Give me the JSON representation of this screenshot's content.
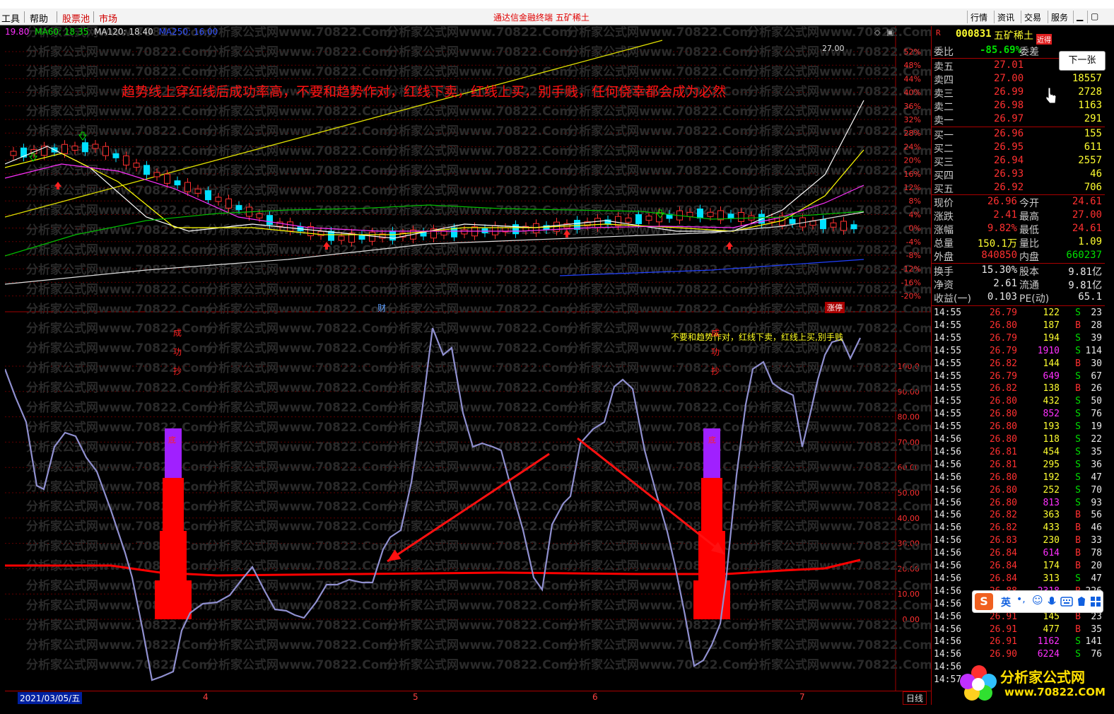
{
  "menubar": {
    "items": [
      "工具",
      "帮助",
      "股票池",
      "市场"
    ],
    "center_title": "通达信金融终端  五矿稀土",
    "right_buttons": [
      "行情",
      "资讯",
      "交易",
      "服务"
    ]
  },
  "ma_legend": {
    "ma20": "19.80",
    "ma60": "MA60: 18.35",
    "ma120": "MA120: 18.40",
    "ma250": "MA250: 16.00"
  },
  "main_chart": {
    "annotation": "趋势线上穿红线后成功率高，不要和趋势作对，红线下卖，红线上买，别手贱，任何侥幸都会成为必然",
    "high_label": "27.00",
    "pct_axis": [
      "52%",
      "48%",
      "44%",
      "40%",
      "36%",
      "32%",
      "28%",
      "24%",
      "20%",
      "16%",
      "12%",
      "8%",
      "4%",
      "0%",
      "-4%",
      "-8%",
      "-12%",
      "-16%",
      "-20%"
    ],
    "marker_cai": "财",
    "marker_zhangting": "涨停",
    "watermark": "分析家公式网www.70822.Com"
  },
  "indicator": {
    "annotation": "不要和趋势作对，红线下卖，红线上买,别手贱",
    "left_chars": [
      "成",
      "功",
      "抄"
    ],
    "right_chars": [
      "成",
      "功",
      "抄"
    ],
    "left_bottom_char": "底",
    "right_bottom_char": "底",
    "axis": [
      "100.0",
      "90.00",
      "80.00",
      "70.00",
      "60.00",
      "50.00",
      "40.00",
      "30.00",
      "20.00",
      "10.00",
      "0.00"
    ]
  },
  "date_bar": {
    "date": "2021/03/05/五",
    "months": [
      "4",
      "5",
      "6",
      "7"
    ],
    "period": "日线"
  },
  "quote": {
    "code": "000831",
    "name": "五矿稀土",
    "badge": "近得",
    "weibi_label": "委比",
    "weibi": "-85.69%",
    "weicha_label": "委差",
    "sells": [
      {
        "label": "卖五",
        "price": "27.01",
        "vol": ""
      },
      {
        "label": "卖四",
        "price": "27.00",
        "vol": "18557"
      },
      {
        "label": "卖三",
        "price": "26.99",
        "vol": "2728"
      },
      {
        "label": "卖二",
        "price": "26.98",
        "vol": "1163"
      },
      {
        "label": "卖一",
        "price": "26.97",
        "vol": "291"
      }
    ],
    "buys": [
      {
        "label": "买一",
        "price": "26.96",
        "vol": "155"
      },
      {
        "label": "买二",
        "price": "26.95",
        "vol": "611"
      },
      {
        "label": "买三",
        "price": "26.94",
        "vol": "2557"
      },
      {
        "label": "买四",
        "price": "26.93",
        "vol": "46"
      },
      {
        "label": "买五",
        "price": "26.92",
        "vol": "706"
      }
    ],
    "stats": [
      {
        "l1": "现价",
        "v1": "26.96",
        "l2": "今开",
        "v2": "24.61"
      },
      {
        "l1": "涨跌",
        "v1": "2.41",
        "l2": "最高",
        "v2": "27.00"
      },
      {
        "l1": "涨幅",
        "v1": "9.82%",
        "l2": "最低",
        "v2": "24.61"
      },
      {
        "l1": "总量",
        "v1": "150.1万",
        "l2": "量比",
        "v2": "1.09"
      },
      {
        "l1": "外盘",
        "v1": "840850",
        "l2": "内盘",
        "v2": "660237"
      }
    ],
    "stats2": [
      {
        "l1": "换手",
        "v1": "15.30%",
        "l2": "股本",
        "v2": "9.81亿"
      },
      {
        "l1": "净资",
        "v1": "2.61",
        "l2": "流通",
        "v2": "9.81亿"
      },
      {
        "l1": "收益(一)",
        "v1": "0.103",
        "l2": "PE(动)",
        "v2": "65.1"
      }
    ],
    "next_button": "下一张"
  },
  "ticks": [
    {
      "t": "14:55",
      "p": "26.79",
      "v": "122",
      "d": "S",
      "n": "23"
    },
    {
      "t": "14:55",
      "p": "26.80",
      "v": "187",
      "d": "B",
      "n": "28"
    },
    {
      "t": "14:55",
      "p": "26.79",
      "v": "194",
      "d": "S",
      "n": "39"
    },
    {
      "t": "14:55",
      "p": "26.79",
      "v": "1910",
      "d": "S",
      "n": "114"
    },
    {
      "t": "14:55",
      "p": "26.82",
      "v": "144",
      "d": "B",
      "n": "30"
    },
    {
      "t": "14:55",
      "p": "26.79",
      "v": "649",
      "d": "S",
      "n": "67"
    },
    {
      "t": "14:55",
      "p": "26.82",
      "v": "138",
      "d": "B",
      "n": "26"
    },
    {
      "t": "14:55",
      "p": "26.80",
      "v": "432",
      "d": "S",
      "n": "50"
    },
    {
      "t": "14:55",
      "p": "26.80",
      "v": "852",
      "d": "S",
      "n": "76"
    },
    {
      "t": "14:55",
      "p": "26.80",
      "v": "193",
      "d": "S",
      "n": "19"
    },
    {
      "t": "14:56",
      "p": "26.80",
      "v": "118",
      "d": "S",
      "n": "22"
    },
    {
      "t": "14:56",
      "p": "26.81",
      "v": "454",
      "d": "S",
      "n": "35"
    },
    {
      "t": "14:56",
      "p": "26.81",
      "v": "295",
      "d": "S",
      "n": "36"
    },
    {
      "t": "14:56",
      "p": "26.80",
      "v": "192",
      "d": "S",
      "n": "47"
    },
    {
      "t": "14:56",
      "p": "26.80",
      "v": "252",
      "d": "S",
      "n": "70"
    },
    {
      "t": "14:56",
      "p": "26.80",
      "v": "813",
      "d": "S",
      "n": "93"
    },
    {
      "t": "14:56",
      "p": "26.82",
      "v": "363",
      "d": "B",
      "n": "56"
    },
    {
      "t": "14:56",
      "p": "26.82",
      "v": "433",
      "d": "B",
      "n": "46"
    },
    {
      "t": "14:56",
      "p": "26.83",
      "v": "230",
      "d": "B",
      "n": "33"
    },
    {
      "t": "14:56",
      "p": "26.84",
      "v": "614",
      "d": "B",
      "n": "78"
    },
    {
      "t": "14:56",
      "p": "26.84",
      "v": "174",
      "d": "B",
      "n": "20"
    },
    {
      "t": "14:56",
      "p": "26.84",
      "v": "313",
      "d": "S",
      "n": "47"
    },
    {
      "t": "14:56",
      "p": "26.88",
      "v": "2318",
      "d": "B",
      "n": "226"
    },
    {
      "t": "14:56",
      "p": "26.88",
      "v": "",
      "d": "",
      "n": ""
    },
    {
      "t": "14:56",
      "p": "26.91",
      "v": "145",
      "d": "B",
      "n": "23"
    },
    {
      "t": "14:56",
      "p": "26.91",
      "v": "477",
      "d": "B",
      "n": "35"
    },
    {
      "t": "14:56",
      "p": "26.91",
      "v": "1162",
      "d": "S",
      "n": "141"
    },
    {
      "t": "14:56",
      "p": "26.90",
      "v": "6224",
      "d": "S",
      "n": "76"
    },
    {
      "t": "14:56",
      "p": "",
      "v": "",
      "d": "",
      "n": ""
    },
    {
      "t": "14:57",
      "p": "",
      "v": "",
      "d": "",
      "n": ""
    }
  ],
  "logo": {
    "text": "分析家公式网",
    "url": "www.70822.COM"
  },
  "ime": {
    "lang": "英"
  },
  "colors": {
    "up": "#ff3030",
    "down": "#00e0ff",
    "ma5": "#ffffff",
    "ma10": "#ffff00",
    "ma20": "#ff30ff",
    "ma60": "#00c000",
    "ma120": "#e0e0e0",
    "ma250": "#2040ff",
    "indicator_line": "#9090d0",
    "red_line": "#ff0000"
  }
}
